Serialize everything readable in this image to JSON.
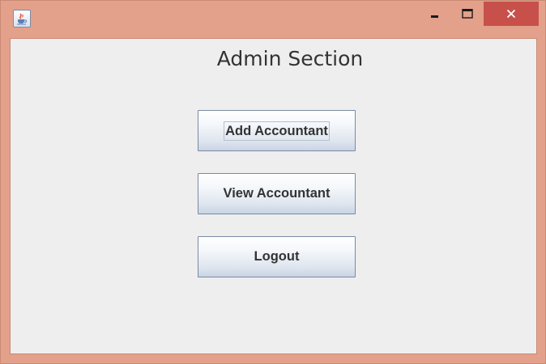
{
  "window": {
    "icon": "java-cup-icon",
    "controls": {
      "minimize": "minimize-icon",
      "maximize": "maximize-icon",
      "close": "close-icon"
    },
    "colors": {
      "frame": "#e3a08a",
      "close_button": "#c7504b",
      "content_background": "#eeeeee"
    }
  },
  "main": {
    "title": "Admin Section",
    "buttons": {
      "add_accountant": "Add Accountant",
      "view_accountant": "View Accountant",
      "logout": "Logout"
    }
  }
}
